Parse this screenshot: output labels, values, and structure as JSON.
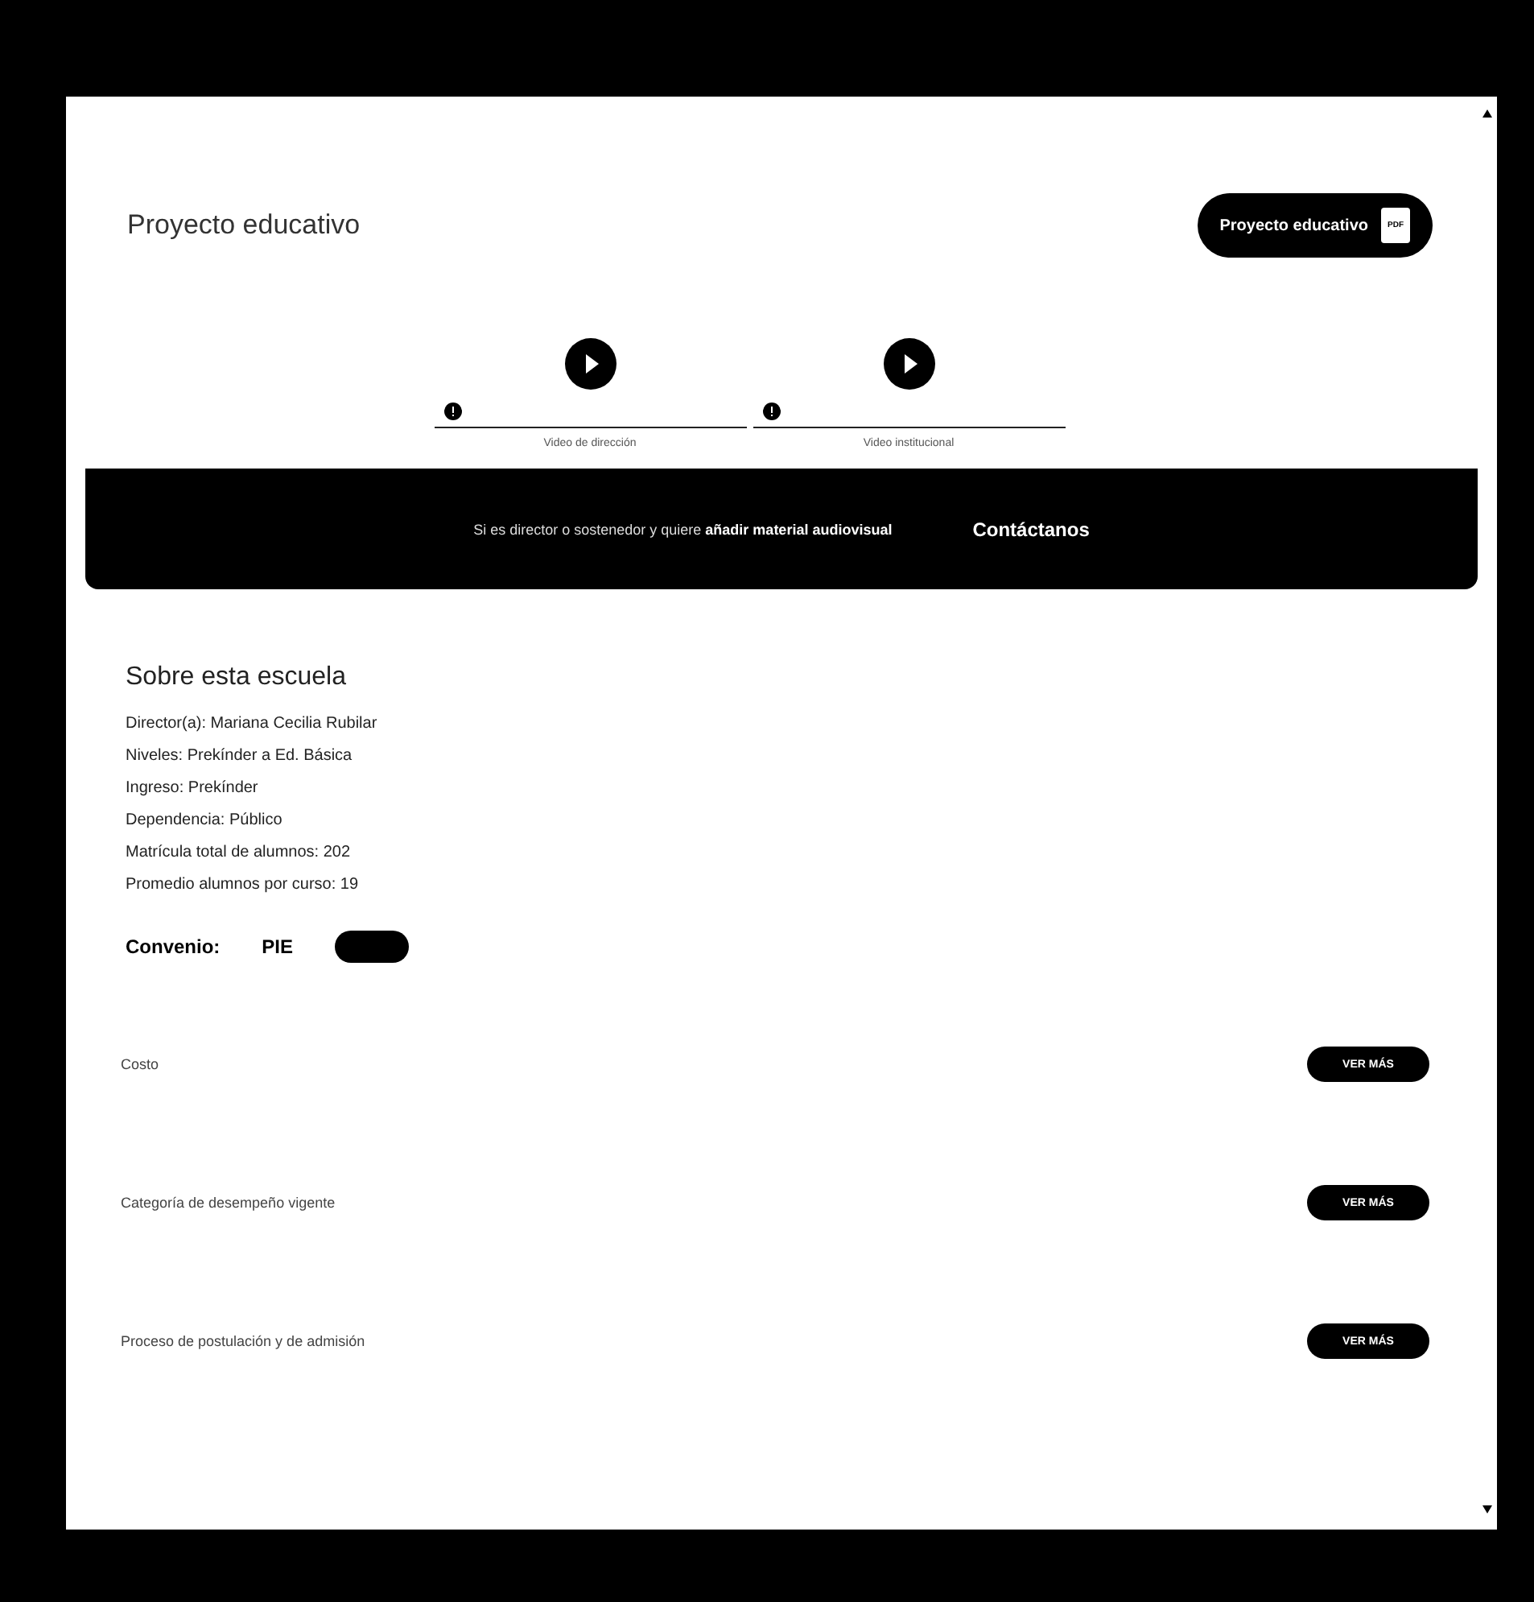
{
  "project": {
    "title": "Proyecto educativo",
    "button": "Proyecto educativo",
    "file_badge": "PDF"
  },
  "videos": [
    {
      "label": "Video de dirección"
    },
    {
      "label": "Video institucional"
    }
  ],
  "banner": {
    "text": "Si es director o sostenedor y quiere **añadir material audiovisual**",
    "link": "Contáctanos"
  },
  "about": {
    "title": "Sobre esta escuela",
    "facts": [
      "Director(a): Mariana Cecilia Rubilar",
      "Niveles: Prekínder a Ed. Básica",
      "Ingreso: Prekínder",
      "Dependencia: Público",
      "Matrícula total de alumnos: 202",
      "Promedio alumnos por curso: 19"
    ],
    "agreement_label": "Convenio:",
    "agreements": [
      {
        "name": "PIE"
      }
    ]
  },
  "sections": [
    {
      "title": "Costo",
      "button": "VER MÁS"
    },
    {
      "title": "Categoría de desempeño vigente",
      "button": "VER MÁS"
    },
    {
      "title": "Proceso de postulación y de admisión",
      "button": "VER MÁS"
    }
  ]
}
